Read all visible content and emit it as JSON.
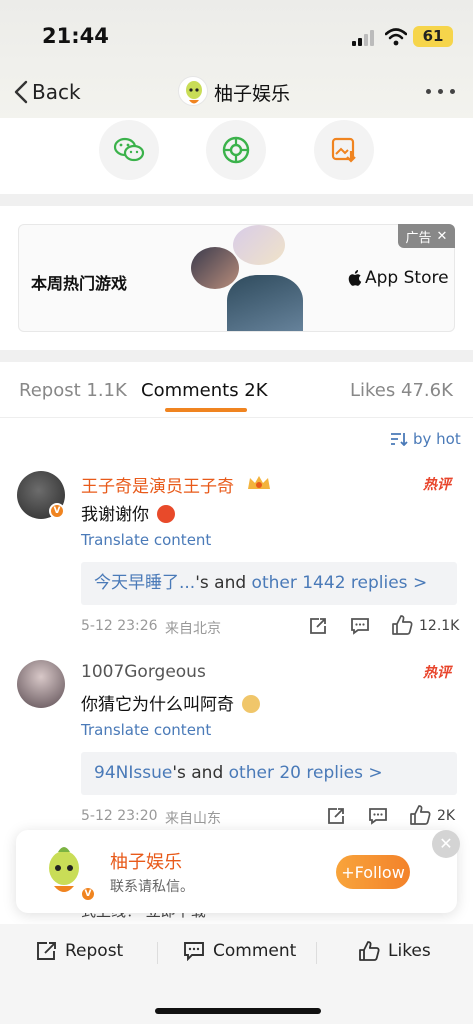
{
  "status_bar": {
    "time": "21:44",
    "battery": "61"
  },
  "nav": {
    "back_label": "Back",
    "title": "柚子娱乐"
  },
  "share": {
    "icons": [
      "wechat-icon",
      "moments-icon",
      "save-image-icon"
    ]
  },
  "ad": {
    "tag": "广告",
    "text": "本周热门游戏",
    "store": "App Store"
  },
  "tabs": {
    "repost": "Repost 1.1K",
    "comments": "Comments 2K",
    "likes": "Likes 47.6K"
  },
  "sort": {
    "label": "by hot"
  },
  "comments": [
    {
      "name": "王子奇是演员王子奇",
      "text": "我谢谢你",
      "hot": "热评",
      "translate": "Translate content",
      "reply_user": "今天早睡了...",
      "reply_mid": "'s and ",
      "reply_link": "other 1442 replies >",
      "time": "5-12 23:26",
      "location": "来自北京",
      "likes": "12.1K"
    },
    {
      "name": "1007Gorgeous",
      "text": "你猜它为什么叫阿奇",
      "hot": "热评",
      "translate": "Translate content",
      "reply_user": "94NIssue",
      "reply_mid": "'s and ",
      "reply_link": "other 20 replies >",
      "time": "5-12 23:20",
      "location": "来自山东",
      "likes": "2K"
    }
  ],
  "follow_popup": {
    "name": "柚子娱乐",
    "subtitle": "联系请私信。",
    "button": "+Follow"
  },
  "partial_text": "式上线！ 立即下载",
  "bottom_bar": {
    "repost": "Repost",
    "comment": "Comment",
    "likes": "Likes"
  },
  "colors": {
    "accent": "#f08420",
    "link": "#4a7ab8",
    "hot": "#e8452c",
    "name_orange": "#e85a1a"
  }
}
